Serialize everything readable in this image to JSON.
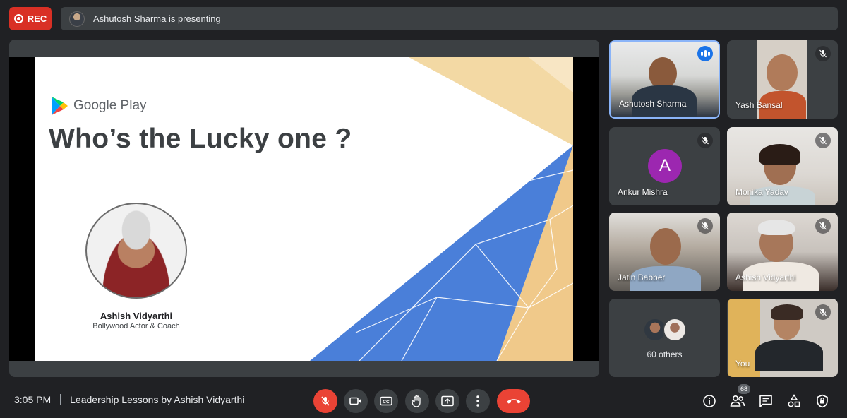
{
  "top_bar": {
    "rec_label": "REC",
    "presenting_text": "Ashutosh Sharma is presenting"
  },
  "slide": {
    "brand": "Google Play",
    "title": "Who’s the Lucky one ?",
    "speaker_name": "Ashish Vidyarthi",
    "speaker_role": "Bollywood Actor & Coach"
  },
  "participants": [
    {
      "name": "Ashutosh Sharma",
      "state": "speaking"
    },
    {
      "name": "Yash Bansal",
      "state": "muted"
    },
    {
      "name": "Ankur Mishra",
      "state": "muted",
      "avatar_letter": "A"
    },
    {
      "name": "Monika Yadav",
      "state": "muted"
    },
    {
      "name": "Jatin Babber",
      "state": "muted"
    },
    {
      "name": "Ashish Vidyarthi",
      "state": "muted"
    },
    {
      "name": "60 others",
      "state": "group"
    },
    {
      "name": "You",
      "state": "muted"
    }
  ],
  "bottom_bar": {
    "time": "3:05 PM",
    "meeting_title": "Leadership Lessons by Ashish Vidyarthi",
    "participant_count": "68"
  },
  "controls": [
    "mic-off-icon",
    "camera-icon",
    "captions-icon",
    "raise-hand-icon",
    "present-icon",
    "more-options-icon",
    "hang-up-icon"
  ],
  "right_controls": [
    "info-icon",
    "people-icon",
    "chat-icon",
    "activities-icon",
    "host-controls-icon"
  ],
  "colors": {
    "background": "#202124",
    "surface": "#3c4043",
    "rec_red": "#d93025",
    "active_blue": "#8ab4f8",
    "slide_blue": "#4a7fd9",
    "slide_beige": "#f3d9a4"
  }
}
